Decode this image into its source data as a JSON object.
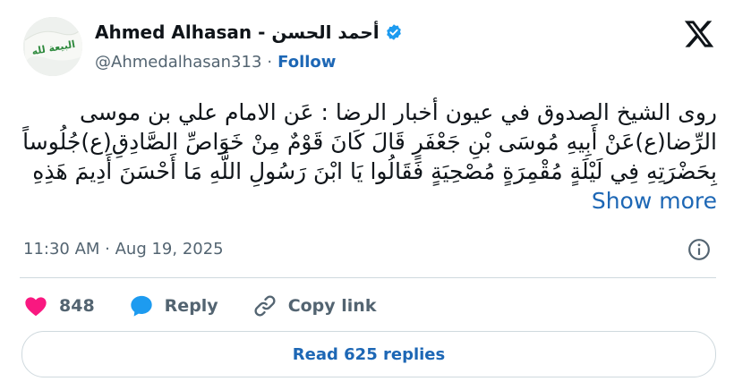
{
  "author": {
    "display_name": "Ahmed Alhasan - أحمد الحسن",
    "handle": "@Ahmedalhasan313",
    "separator": "·",
    "follow_label": "Follow",
    "avatar_flag_text": "البيعة لله"
  },
  "tweet": {
    "text": "روى الشيخ الصدوق في عيون أخبار الرضا : عَن الامام علي بن موسى الرِّضا(ع)عَنْ أَبِيهِ مُوسَى بْنِ جَعْفَرٍ قَالَ كَانَ قَوْمٌ مِنْ خَوَاصِّ الصَّادِقِ(ع)جُلُوساً بِحَضْرَتِهِ فِي لَيْلَةٍ مُقْمِرَةٍ مُصْحِيَةٍ فَقَالُوا يَا ابْنَ رَسُولِ اللَّهِ مَا أَحْسَنَ أَدِيمَ هَذِهِ",
    "show_more": "Show more",
    "timestamp": "11:30 AM · Aug 19, 2025"
  },
  "actions": {
    "like_count": "848",
    "reply_label": "Reply",
    "copy_link_label": "Copy link"
  },
  "read_replies_label": "Read 625 replies",
  "colors": {
    "accent": "#1d67b5",
    "like": "#f91880",
    "reply": "#1d9bf0",
    "verified": "#1d9bf0",
    "muted": "#536471",
    "border": "#cfd9de"
  },
  "icons": [
    "verified-badge-icon",
    "x-logo-icon",
    "info-icon",
    "heart-icon",
    "speech-bubble-icon",
    "link-icon"
  ]
}
